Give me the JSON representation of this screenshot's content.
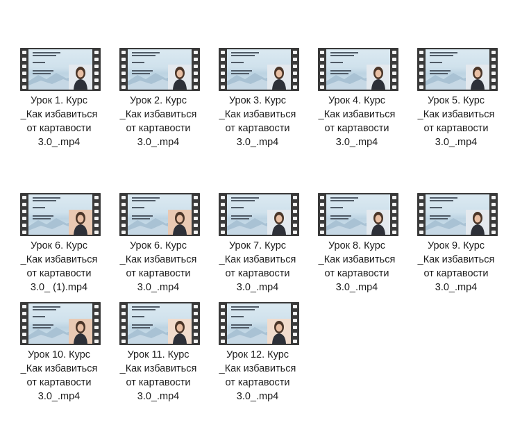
{
  "window": {
    "view": "large-icons"
  },
  "files": [
    {
      "name": "Урок 1. Курс _Как избавиться от картавости 3.0_.mp4",
      "label": "Урок 1. Курс\n_Как избавиться\nот картавости\n3.0_.mp4",
      "type": "video-file-icon",
      "panel": "pale"
    },
    {
      "name": "Урок 2. Курс _Как избавиться от картавости 3.0_.mp4",
      "label": "Урок 2. Курс\n_Как избавиться\nот картавости\n3.0_.mp4",
      "type": "video-file-icon",
      "panel": "pale"
    },
    {
      "name": "Урок 3. Курс _Как избавиться от картавости 3.0_.mp4",
      "label": "Урок 3. Курс\n_Как избавиться\nот картавости\n3.0_.mp4",
      "type": "video-file-icon",
      "panel": "pale"
    },
    {
      "name": "Урок 4. Курс _Как избавиться от картавости 3.0_.mp4",
      "label": "Урок 4. Курс\n_Как избавиться\nот картавости\n3.0_.mp4",
      "type": "video-file-icon",
      "panel": "pale"
    },
    {
      "name": "Урок 5. Курс _Как избавиться от картавости 3.0_.mp4",
      "label": "Урок 5. Курс\n_Как избавиться\nот картавости\n3.0_.mp4",
      "type": "video-file-icon",
      "panel": "pale"
    },
    {
      "name": "Урок 6. Курс _Как избавиться от картавости 3.0_ (1).mp4",
      "label": "Урок 6. Курс\n_Как избавиться\nот картавости\n3.0_ (1).mp4",
      "type": "video-file-icon",
      "panel": "warm"
    },
    {
      "name": "Урок 6. Курс _Как избавиться от картавости 3.0_.mp4",
      "label": "Урок 6. Курс\n_Как избавиться\nот картавости\n3.0_.mp4",
      "type": "video-file-icon",
      "panel": "warm"
    },
    {
      "name": "Урок 7. Курс _Как избавиться от картавости 3.0_.mp4",
      "label": "Урок 7. Курс\n_Как избавиться\nот картавости\n3.0_.mp4",
      "type": "video-file-icon",
      "panel": "pale"
    },
    {
      "name": "Урок 8. Курс _Как избавиться от картавости 3.0_.mp4",
      "label": "Урок 8. Курс\n_Как избавиться\nот картавости\n3.0_.mp4",
      "type": "video-file-icon",
      "panel": "pale"
    },
    {
      "name": "Урок 9. Курс _Как избавиться от картавости 3.0_.mp4",
      "label": "Урок 9. Курс\n_Как избавиться\nот картавости\n3.0_.mp4",
      "type": "video-file-icon",
      "panel": "pale"
    },
    {
      "name": "Урок 10. Курс _Как избавиться от картавости 3.0_.mp4",
      "label": "Урок 10. Курс\n_Как избавиться\nот картавости\n3.0_.mp4",
      "type": "video-file-icon",
      "panel": "warm"
    },
    {
      "name": "Урок 11. Курс _Как избавиться от картавости 3.0_.mp4",
      "label": "Урок 11. Курс\n_Как избавиться\nот картавости\n3.0_.mp4",
      "type": "video-file-icon",
      "panel": "bright"
    },
    {
      "name": "Урок 12. Курс _Как избавиться от картавости 3.0_.mp4",
      "label": "Урок 12. Курс\n_Как избавиться\nот картавости\n3.0_.mp4",
      "type": "video-file-icon",
      "panel": "bright"
    }
  ],
  "colors": {
    "film": "#3a3a3a",
    "text": "#1c1c1c",
    "background": "#ffffff"
  }
}
